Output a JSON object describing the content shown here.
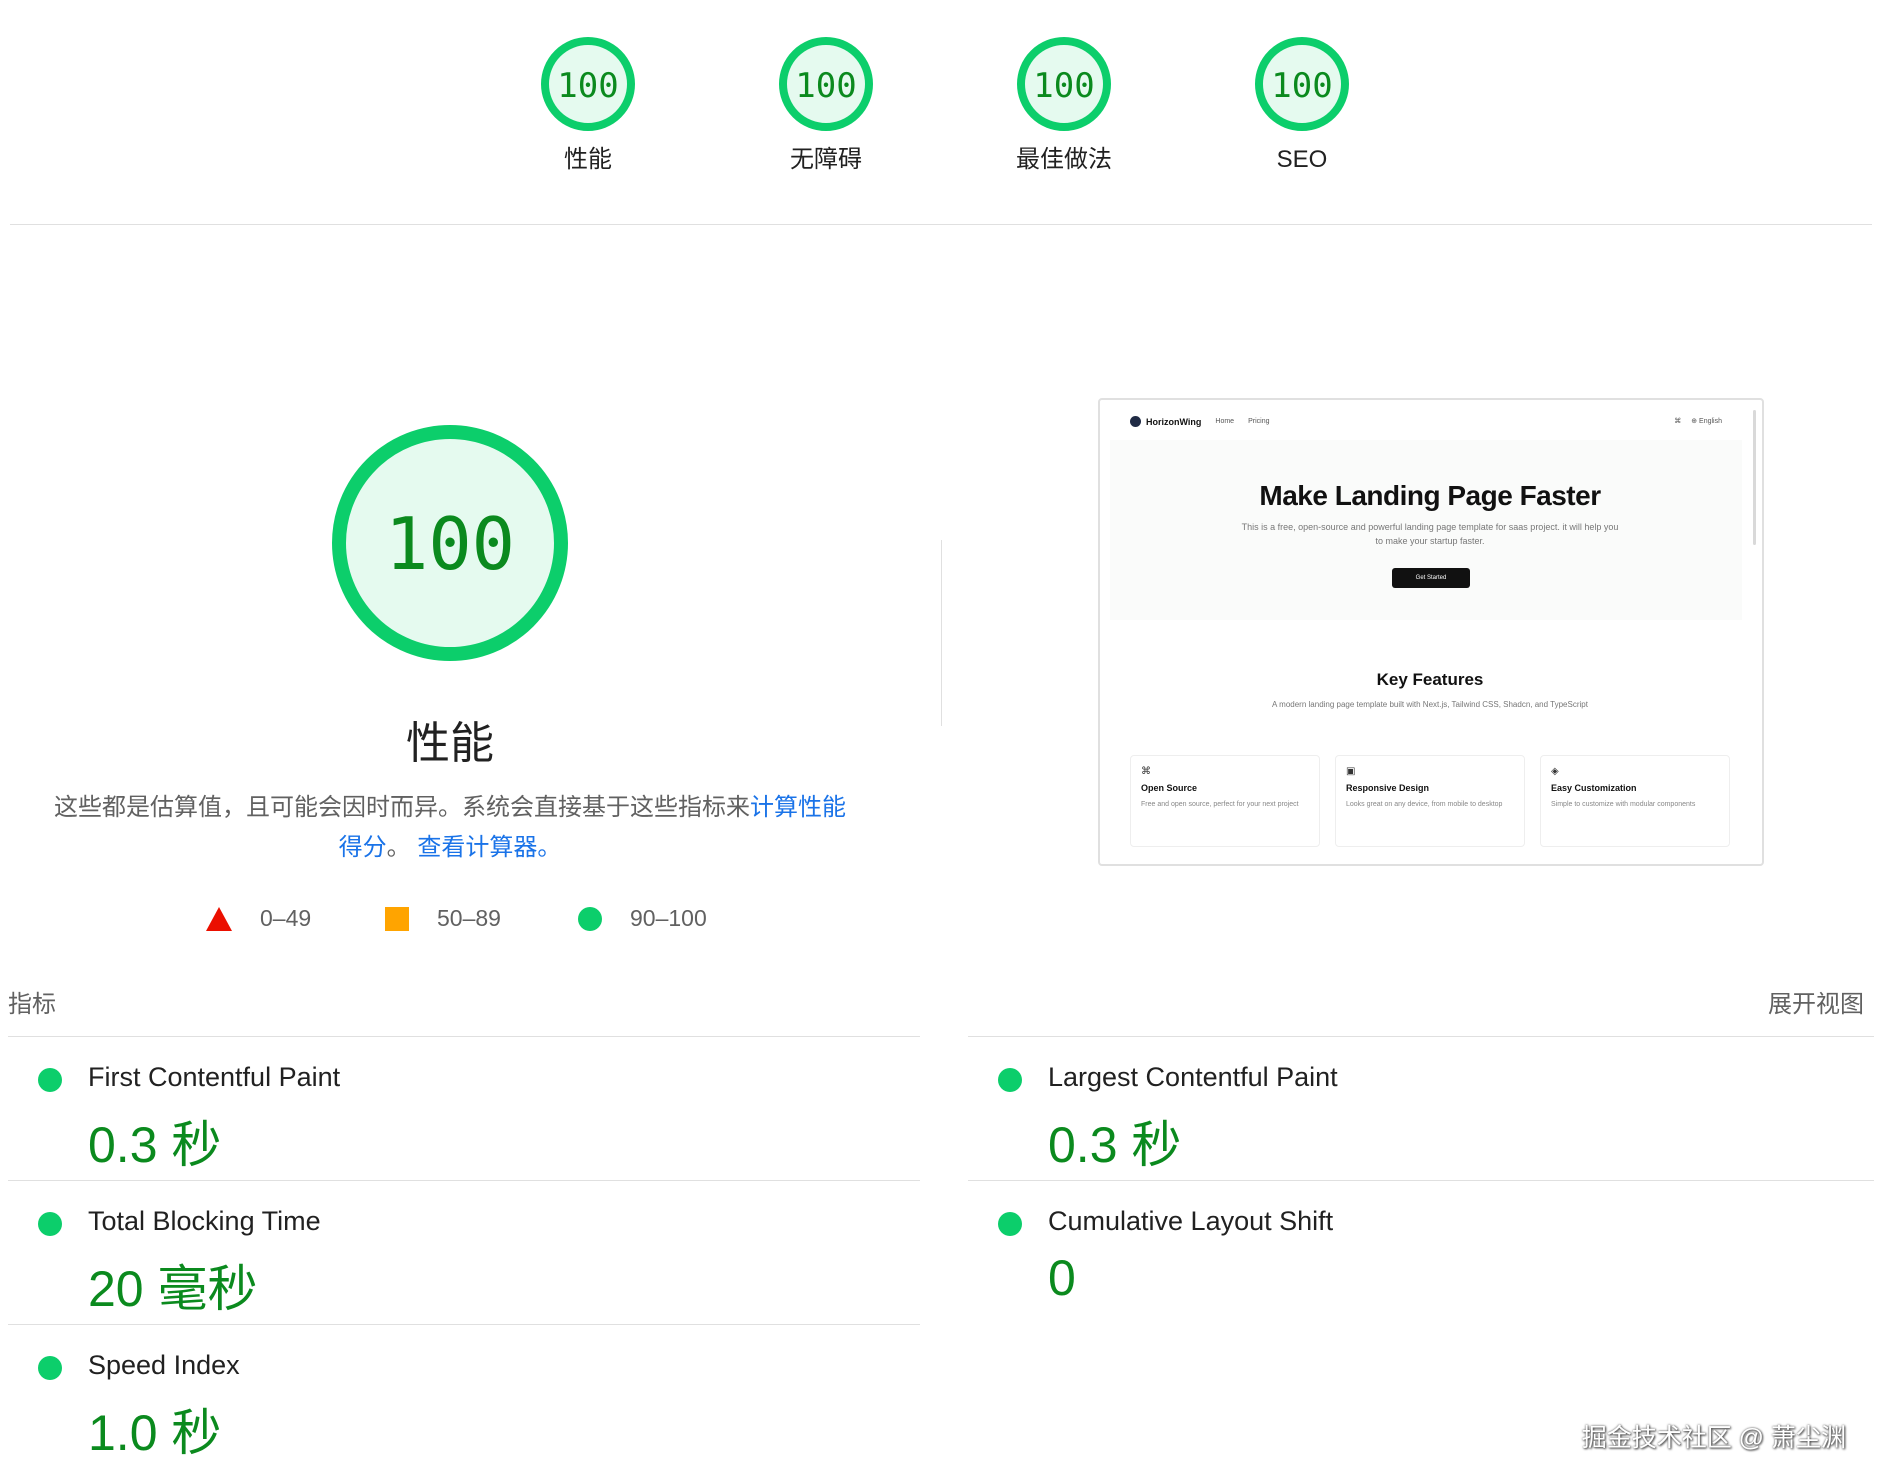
{
  "top_gauges": [
    {
      "score": "100",
      "label": "性能"
    },
    {
      "score": "100",
      "label": "无障碍"
    },
    {
      "score": "100",
      "label": "最佳做法"
    },
    {
      "score": "100",
      "label": "SEO"
    }
  ],
  "performance": {
    "score": "100",
    "title": "性能",
    "description": "这些都是估算值，且可能会因时而异。系统会直接基于这些指标来",
    "calc_link": "计算性能得分",
    "separator": "。 ",
    "calculator_link": "查看计算器。"
  },
  "legend": [
    {
      "range": "0–49",
      "shape": "triangle",
      "color": "#eb0f00"
    },
    {
      "range": "50–89",
      "shape": "square",
      "color": "#ffa400"
    },
    {
      "range": "90–100",
      "shape": "circle",
      "color": "#0cce6b"
    }
  ],
  "thumbnail": {
    "brand": "HorizonWing",
    "nav_links": [
      "Home",
      "Pricing"
    ],
    "right_items": [
      "⌘",
      "⊕ English"
    ],
    "hero_title": "Make Landing Page Faster",
    "hero_sub": "This is a free, open-source and powerful landing page template for saas project. it will help you to make your startup faster.",
    "cta": "Get Started",
    "features_title": "Key Features",
    "features_sub": "A modern landing page template built with Next.js, Tailwind CSS, Shadcn, and TypeScript",
    "cards": [
      {
        "icon": "⌘",
        "title": "Open Source",
        "desc": "Free and open source, perfect for your next project"
      },
      {
        "icon": "▣",
        "title": "Responsive Design",
        "desc": "Looks great on any device, from mobile to desktop"
      },
      {
        "icon": "◈",
        "title": "Easy Customization",
        "desc": "Simple to customize with modular components"
      }
    ]
  },
  "metrics": {
    "label": "指标",
    "expand": "展开视图",
    "items": [
      {
        "name": "First Contentful Paint",
        "value": "0.3 秒"
      },
      {
        "name": "Largest Contentful Paint",
        "value": "0.3 秒"
      },
      {
        "name": "Total Blocking Time",
        "value": "20 毫秒"
      },
      {
        "name": "Cumulative Layout Shift",
        "value": "0"
      },
      {
        "name": "Speed Index",
        "value": "1.0 秒"
      }
    ]
  },
  "colors": {
    "pass_green": "#0cce6b",
    "pass_fill": "#e5faef",
    "pass_text": "#0b8a1e",
    "link_blue": "#1a73e8"
  },
  "watermark": "掘金技术社区 @ 萧尘渊"
}
